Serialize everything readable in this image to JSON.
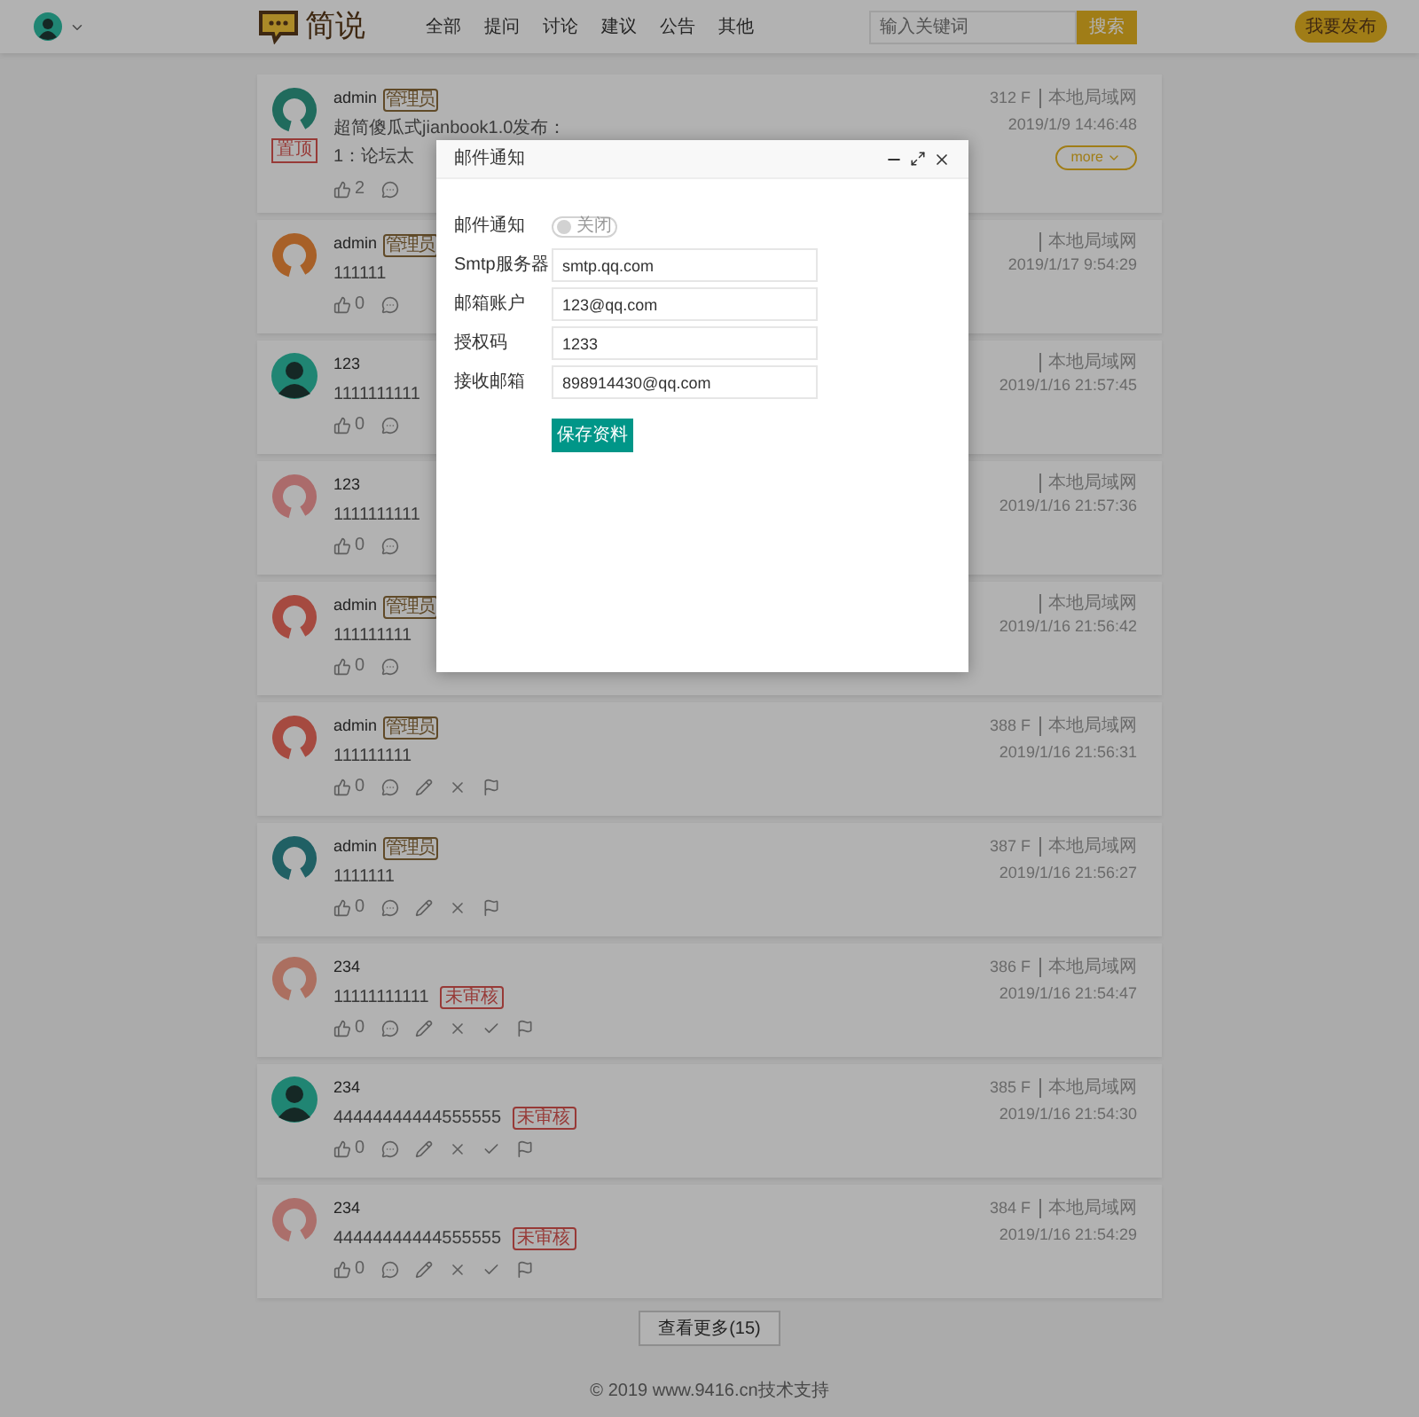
{
  "header": {
    "logo_text": "简说",
    "nav": [
      {
        "label": "全部"
      },
      {
        "label": "提问"
      },
      {
        "label": "讨论"
      },
      {
        "label": "建议"
      },
      {
        "label": "公告"
      },
      {
        "label": "其他"
      }
    ],
    "search": {
      "placeholder": "输入关键词",
      "button": "搜索"
    },
    "publish_button": "我要发布"
  },
  "posts": [
    {
      "avatar": {
        "kind": "ring"
      },
      "name": "admin",
      "role_badge": "管理员",
      "pinned_badge": "置顶",
      "floor": "312 F",
      "network": "本地局域网",
      "time": "2019/1/9 14:46:48",
      "lines": [
        "超简傻瓜式jianbook1.0发布：",
        "1：论坛太"
      ],
      "likes": "2",
      "actions": [
        {
          "kind": "comment"
        }
      ],
      "more_button": "more"
    },
    {
      "avatar": {
        "kind": "ring"
      },
      "name": "admin",
      "role_badge": "管理员",
      "network": "本地局域网",
      "time": "2019/1/17 9:54:29",
      "lines": [
        "111111"
      ],
      "likes": "0",
      "actions": [
        {
          "kind": "comment"
        }
      ]
    },
    {
      "avatar": {
        "kind": "silhouette"
      },
      "name": "123",
      "network": "本地局域网",
      "time": "2019/1/16 21:57:45",
      "lines": [
        "1111111111"
      ],
      "likes": "0",
      "actions": [
        {
          "kind": "comment"
        }
      ]
    },
    {
      "avatar": {
        "kind": "ring"
      },
      "name": "123",
      "network": "本地局域网",
      "time": "2019/1/16 21:57:36",
      "lines": [
        "1111111111"
      ],
      "likes": "0",
      "actions": [
        {
          "kind": "comment"
        }
      ]
    },
    {
      "avatar": {
        "kind": "ring"
      },
      "name": "admin",
      "role_badge": "管理员",
      "network": "本地局域网",
      "time": "2019/1/16 21:56:42",
      "lines": [
        "111111111"
      ],
      "likes": "0",
      "actions": [
        {
          "kind": "comment"
        }
      ]
    },
    {
      "avatar": {
        "kind": "ring"
      },
      "name": "admin",
      "role_badge": "管理员",
      "floor": "388 F",
      "network": "本地局域网",
      "time": "2019/1/16 21:56:31",
      "lines": [
        "111111111"
      ],
      "likes": "0",
      "actions": [
        {
          "kind": "comment"
        },
        {
          "kind": "edit"
        },
        {
          "kind": "delete"
        },
        {
          "kind": "flag"
        }
      ]
    },
    {
      "avatar": {
        "kind": "ring"
      },
      "name": "admin",
      "role_badge": "管理员",
      "floor": "387 F",
      "network": "本地局域网",
      "time": "2019/1/16 21:56:27",
      "lines": [
        "1111111"
      ],
      "likes": "0",
      "actions": [
        {
          "kind": "comment"
        },
        {
          "kind": "edit"
        },
        {
          "kind": "delete"
        },
        {
          "kind": "flag"
        }
      ]
    },
    {
      "avatar": {
        "kind": "ring"
      },
      "name": "234",
      "status_badge": "未审核",
      "floor": "386 F",
      "network": "本地局域网",
      "time": "2019/1/16 21:54:47",
      "lines": [
        "11111111111"
      ],
      "likes": "0",
      "actions": [
        {
          "kind": "comment"
        },
        {
          "kind": "edit"
        },
        {
          "kind": "delete"
        },
        {
          "kind": "approve"
        },
        {
          "kind": "flag"
        }
      ]
    },
    {
      "avatar": {
        "kind": "silhouette"
      },
      "name": "234",
      "status_badge": "未审核",
      "floor": "385 F",
      "network": "本地局域网",
      "time": "2019/1/16 21:54:30",
      "lines": [
        "44444444444555555"
      ],
      "likes": "0",
      "actions": [
        {
          "kind": "comment"
        },
        {
          "kind": "edit"
        },
        {
          "kind": "delete"
        },
        {
          "kind": "approve"
        },
        {
          "kind": "flag"
        }
      ]
    },
    {
      "avatar": {
        "kind": "ring"
      },
      "name": "234",
      "status_badge": "未审核",
      "floor": "384 F",
      "network": "本地局域网",
      "time": "2019/1/16 21:54:29",
      "lines": [
        "44444444444555555"
      ],
      "likes": "0",
      "actions": [
        {
          "kind": "comment"
        },
        {
          "kind": "edit"
        },
        {
          "kind": "delete"
        },
        {
          "kind": "approve"
        },
        {
          "kind": "flag"
        }
      ]
    }
  ],
  "load_more": "查看更多(15)",
  "footer": "© 2019 www.9416.cn技术支持",
  "modal": {
    "title": "邮件通知",
    "fields": [
      {
        "kind": "toggle",
        "label": "邮件通知",
        "on": false,
        "state_text": "关闭"
      },
      {
        "kind": "input",
        "label": "Smtp服务器",
        "value": "smtp.qq.com"
      },
      {
        "kind": "input",
        "label": "邮箱账户",
        "value": "123@qq.com"
      },
      {
        "kind": "input",
        "label": "授权码",
        "value": "1233"
      },
      {
        "kind": "input",
        "label": "接收邮箱",
        "value": "898914430@qq.com"
      }
    ],
    "save_button": "保存资料"
  }
}
